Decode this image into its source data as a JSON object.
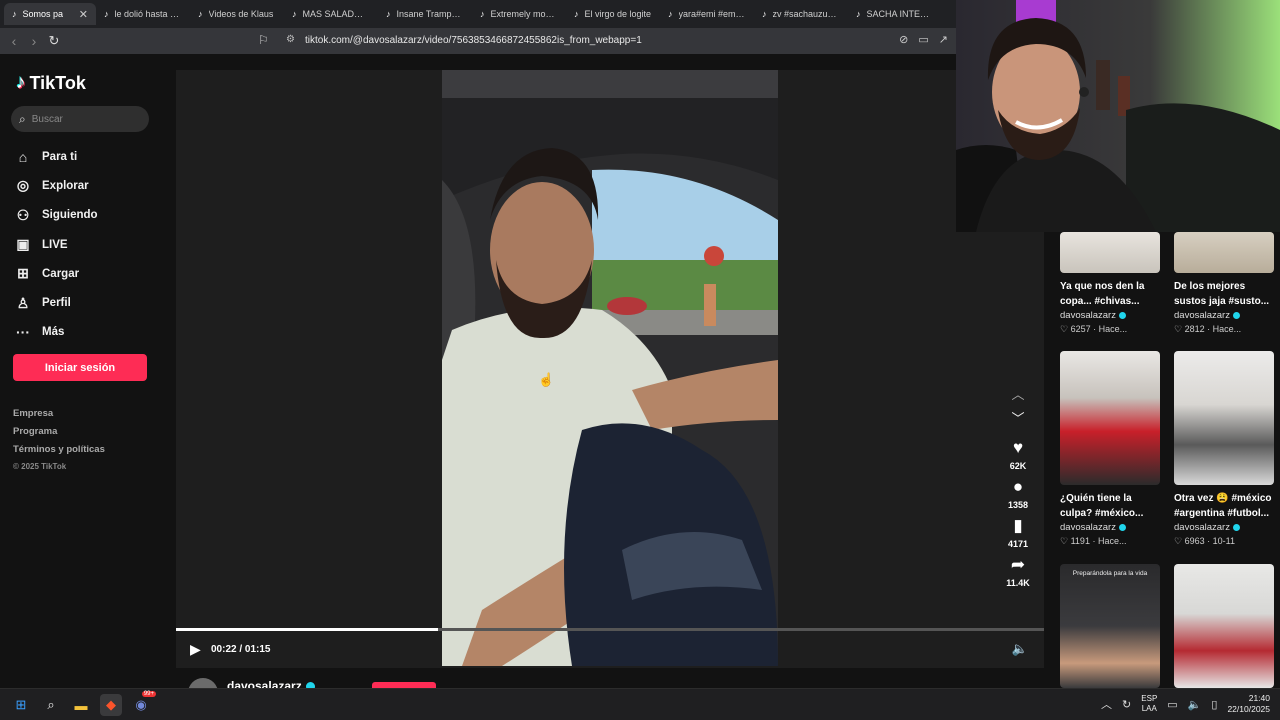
{
  "browser": {
    "tabs": [
      {
        "label": "Somos pa",
        "active": true
      },
      {
        "label": "le dolió hasta el a"
      },
      {
        "label": "Videos de Klaus"
      },
      {
        "label": "MAS SALADO XD"
      },
      {
        "label": "Insane Trampolin"
      },
      {
        "label": "Extremely mount"
      },
      {
        "label": "El virgo de logite"
      },
      {
        "label": "yara#emi #emiku"
      },
      {
        "label": "zv #sachauzuma"
      },
      {
        "label": "SACHA INTENTA"
      }
    ],
    "url": "tiktok.com/@davosalazarz/video/7563853466872455862is_from_webapp=1"
  },
  "sidebar": {
    "logo_text": "TikTok",
    "search_placeholder": "Buscar",
    "nav": [
      {
        "label": "Para ti",
        "icon": "home-icon"
      },
      {
        "label": "Explorar",
        "icon": "compass-icon"
      },
      {
        "label": "Siguiendo",
        "icon": "following-icon"
      },
      {
        "label": "LIVE",
        "icon": "live-icon"
      },
      {
        "label": "Cargar",
        "icon": "upload-icon"
      },
      {
        "label": "Perfil",
        "icon": "profile-icon"
      },
      {
        "label": "Más",
        "icon": "more-icon"
      }
    ],
    "login_label": "Iniciar sesión",
    "footer": [
      "Empresa",
      "Programa",
      "Términos y políticas"
    ],
    "copyright": "© 2025 TikTok"
  },
  "player": {
    "time_current": "00:22",
    "time_total": "01:15",
    "time_display": "00:22 / 01:15",
    "progress": 0.302
  },
  "actions": {
    "likes": "62K",
    "comments": "1358",
    "saves": "4171",
    "shares": "11.4K"
  },
  "author": {
    "name": "davosalazarz"
  },
  "recommendations": [
    {
      "caption_l1": "Ya que nos den la",
      "caption_l2": "copa... #chivas...",
      "author": "davosalazarz",
      "likes": "6257",
      "when": "Hace..."
    },
    {
      "caption_l1": "De los mejores",
      "caption_l2": "sustos jaja #susto...",
      "author": "davosalazarz",
      "likes": "2812",
      "when": "Hace..."
    },
    {
      "caption_l1": "¿Quién tiene la",
      "caption_l2": "culpa? #méxico...",
      "author": "davosalazarz",
      "likes": "1191",
      "when": "Hace..."
    },
    {
      "caption_l1": "Otra vez 😩 #méxico",
      "caption_l2": "#argentina #futbol...",
      "author": "davosalazarz",
      "likes": "6963",
      "when": "10-11"
    },
    {
      "thumb_text": "Preparándola para la vida"
    }
  ],
  "taskbar": {
    "lang_top": "ESP",
    "lang_bottom": "LAA",
    "time": "21:40",
    "date": "22/10/2025",
    "discord_badge": "99+"
  },
  "colors": {
    "accent": "#fe2c55",
    "verified": "#20d5ec"
  }
}
